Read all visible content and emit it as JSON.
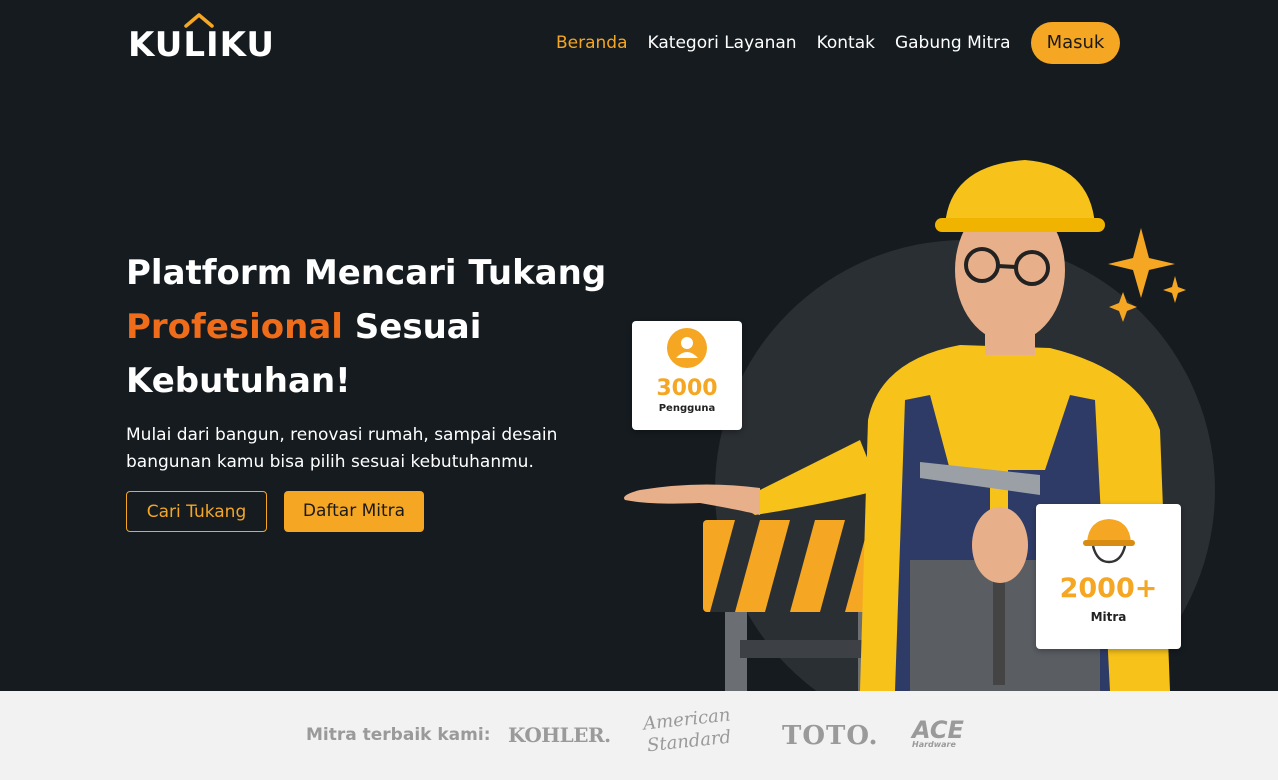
{
  "brand": {
    "name": "KULIKU"
  },
  "nav": {
    "items": [
      "Beranda",
      "Kategori Layanan",
      "Kontak",
      "Gabung Mitra"
    ],
    "login": "Masuk"
  },
  "hero": {
    "title_line1": "Platform Mencari Tukang",
    "title_accent": "Profesional",
    "title_rest": " Sesuai",
    "title_line3": "Kebutuhan!",
    "subtitle": "Mulai dari bangun, renovasi rumah, sampai desain bangunan kamu bisa pilih sesuai kebutuhanmu.",
    "cta_primary": "Cari Tukang",
    "cta_secondary": "Daftar Mitra"
  },
  "stats": {
    "users_value": "3000",
    "users_label": "Pengguna",
    "mitra_value": "2000+",
    "mitra_label": "Mitra"
  },
  "partners": {
    "label": "Mitra terbaik kami:",
    "brands": [
      "KOHLER.",
      "American Standard",
      "TOTO.",
      "ACE",
      "Hardware"
    ]
  },
  "colors": {
    "accent": "#f5a623",
    "accent_orange": "#ef6c1a",
    "background": "#151b1f"
  }
}
